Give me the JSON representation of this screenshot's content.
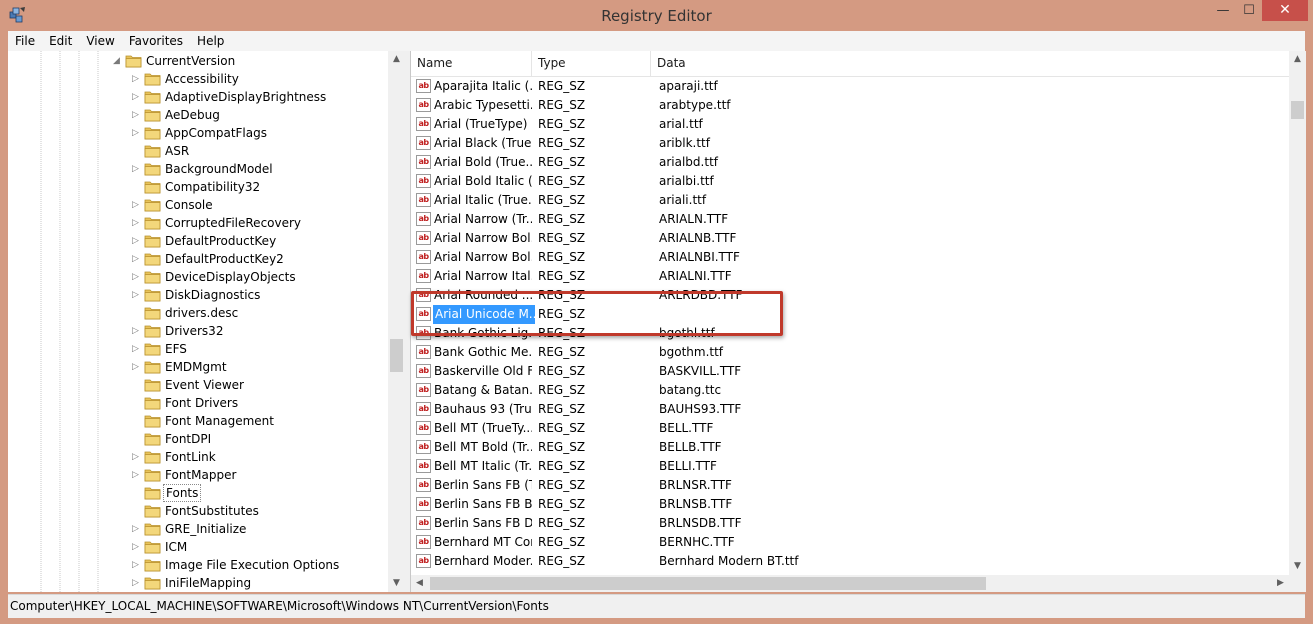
{
  "window": {
    "title": "Registry Editor",
    "minimize": "—",
    "maximize": "☐",
    "close": "✕"
  },
  "menu": [
    "File",
    "Edit",
    "View",
    "Favorites",
    "Help"
  ],
  "tree": {
    "parent": "CurrentVersion",
    "selected": "Fonts",
    "items": [
      {
        "label": "Accessibility",
        "expandable": true
      },
      {
        "label": "AdaptiveDisplayBrightness",
        "expandable": true
      },
      {
        "label": "AeDebug",
        "expandable": true
      },
      {
        "label": "AppCompatFlags",
        "expandable": true
      },
      {
        "label": "ASR",
        "expandable": false
      },
      {
        "label": "BackgroundModel",
        "expandable": true
      },
      {
        "label": "Compatibility32",
        "expandable": false
      },
      {
        "label": "Console",
        "expandable": true
      },
      {
        "label": "CorruptedFileRecovery",
        "expandable": true
      },
      {
        "label": "DefaultProductKey",
        "expandable": true
      },
      {
        "label": "DefaultProductKey2",
        "expandable": true
      },
      {
        "label": "DeviceDisplayObjects",
        "expandable": true
      },
      {
        "label": "DiskDiagnostics",
        "expandable": true
      },
      {
        "label": "drivers.desc",
        "expandable": false
      },
      {
        "label": "Drivers32",
        "expandable": true
      },
      {
        "label": "EFS",
        "expandable": true
      },
      {
        "label": "EMDMgmt",
        "expandable": true
      },
      {
        "label": "Event Viewer",
        "expandable": false
      },
      {
        "label": "Font Drivers",
        "expandable": false
      },
      {
        "label": "Font Management",
        "expandable": false
      },
      {
        "label": "FontDPI",
        "expandable": false
      },
      {
        "label": "FontLink",
        "expandable": true
      },
      {
        "label": "FontMapper",
        "expandable": true
      },
      {
        "label": "Fonts",
        "expandable": false
      },
      {
        "label": "FontSubstitutes",
        "expandable": false
      },
      {
        "label": "GRE_Initialize",
        "expandable": true
      },
      {
        "label": "ICM",
        "expandable": true
      },
      {
        "label": "Image File Execution Options",
        "expandable": true
      },
      {
        "label": "IniFileMapping",
        "expandable": true
      }
    ]
  },
  "list": {
    "headers": {
      "name": "Name",
      "type": "Type",
      "data": "Data"
    },
    "icon_text": "ab",
    "rows": [
      {
        "name": "Aparajita Italic (...",
        "type": "REG_SZ",
        "data": "aparaji.ttf"
      },
      {
        "name": "Arabic Typesetti...",
        "type": "REG_SZ",
        "data": "arabtype.ttf"
      },
      {
        "name": "Arial (TrueType)",
        "type": "REG_SZ",
        "data": "arial.ttf"
      },
      {
        "name": "Arial Black (True...",
        "type": "REG_SZ",
        "data": "ariblk.ttf"
      },
      {
        "name": "Arial Bold (True...",
        "type": "REG_SZ",
        "data": "arialbd.ttf"
      },
      {
        "name": "Arial Bold Italic (...",
        "type": "REG_SZ",
        "data": "arialbi.ttf"
      },
      {
        "name": "Arial Italic (True...",
        "type": "REG_SZ",
        "data": "ariali.ttf"
      },
      {
        "name": "Arial Narrow (Tr...",
        "type": "REG_SZ",
        "data": "ARIALN.TTF"
      },
      {
        "name": "Arial Narrow Bol...",
        "type": "REG_SZ",
        "data": "ARIALNB.TTF"
      },
      {
        "name": "Arial Narrow Bol...",
        "type": "REG_SZ",
        "data": "ARIALNBI.TTF"
      },
      {
        "name": "Arial Narrow Ital...",
        "type": "REG_SZ",
        "data": "ARIALNI.TTF"
      },
      {
        "name": "Arial Rounded ...",
        "type": "REG_SZ",
        "data": "ARLRDBD.TTF"
      },
      {
        "name": "Arial Unicode M...",
        "type": "REG_SZ",
        "data": "",
        "selected": true
      },
      {
        "name": "Bank Gothic Lig...",
        "type": "REG_SZ",
        "data": "bgothl.ttf"
      },
      {
        "name": "Bank Gothic Me...",
        "type": "REG_SZ",
        "data": "bgothm.ttf"
      },
      {
        "name": "Baskerville Old F...",
        "type": "REG_SZ",
        "data": "BASKVILL.TTF"
      },
      {
        "name": "Batang & Batan...",
        "type": "REG_SZ",
        "data": "batang.ttc"
      },
      {
        "name": "Bauhaus 93 (Tru...",
        "type": "REG_SZ",
        "data": "BAUHS93.TTF"
      },
      {
        "name": "Bell MT (TrueTy...",
        "type": "REG_SZ",
        "data": "BELL.TTF"
      },
      {
        "name": "Bell MT Bold (Tr...",
        "type": "REG_SZ",
        "data": "BELLB.TTF"
      },
      {
        "name": "Bell MT Italic (Tr...",
        "type": "REG_SZ",
        "data": "BELLI.TTF"
      },
      {
        "name": "Berlin Sans FB (T...",
        "type": "REG_SZ",
        "data": "BRLNSR.TTF"
      },
      {
        "name": "Berlin Sans FB B...",
        "type": "REG_SZ",
        "data": "BRLNSB.TTF"
      },
      {
        "name": "Berlin Sans FB D...",
        "type": "REG_SZ",
        "data": "BRLNSDB.TTF"
      },
      {
        "name": "Bernhard MT Con...",
        "type": "REG_SZ",
        "data": "BERNHC.TTF"
      },
      {
        "name": "Bernhard Moder...",
        "type": "REG_SZ",
        "data": "Bernhard Modern BT.ttf"
      }
    ]
  },
  "statusbar": {
    "path": "Computer\\HKEY_LOCAL_MACHINE\\SOFTWARE\\Microsoft\\Windows NT\\CurrentVersion\\Fonts"
  },
  "colors": {
    "frame": "#d49a82",
    "close": "#c7504a",
    "selection": "#3399ff",
    "annotation": "#c0392b"
  }
}
